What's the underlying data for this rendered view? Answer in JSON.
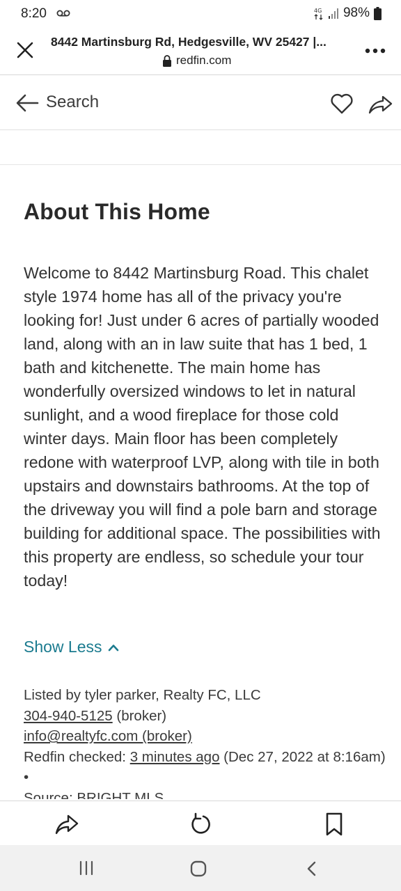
{
  "status_bar": {
    "time": "8:20",
    "battery": "98%"
  },
  "browser": {
    "title": "8442 Martinsburg Rd, Hedgesville, WV 25427 |...",
    "domain": "redfin.com"
  },
  "page_nav": {
    "back_label": "Search"
  },
  "about": {
    "heading": "About This Home",
    "description": "Welcome to 8442 Martinsburg Road. This chalet style 1974 home has all of the privacy you're looking for! Just under 6 acres of partially wooded land, along with an in law suite that has 1 bed, 1 bath and kitchenette. The main home has wonderfully oversized windows to let in natural sunlight, and a wood fireplace for those cold winter days. Main floor has been completely redone with waterproof LVP, along with tile in both upstairs and downstairs bathrooms. At the top of the driveway you will find a pole barn and storage building for additional space. The possibilities with this property are endless, so schedule your tour today!",
    "show_less": "Show Less"
  },
  "listing": {
    "listed_by": "Listed by tyler parker, Realty FC, LLC",
    "phone": "304-940-5125",
    "phone_suffix": " (broker)",
    "email": "info@realtyfc.com (broker)",
    "checked_prefix": "Redfin checked: ",
    "checked_link": "3 minutes ago",
    "checked_suffix": " (Dec 27, 2022 at 8:16am) •",
    "source": "Source: BRIGHT MLS"
  },
  "colors": {
    "link_teal": "#1b7b8f",
    "text": "#333333",
    "nav_bar_bg": "#f1f1f1"
  }
}
